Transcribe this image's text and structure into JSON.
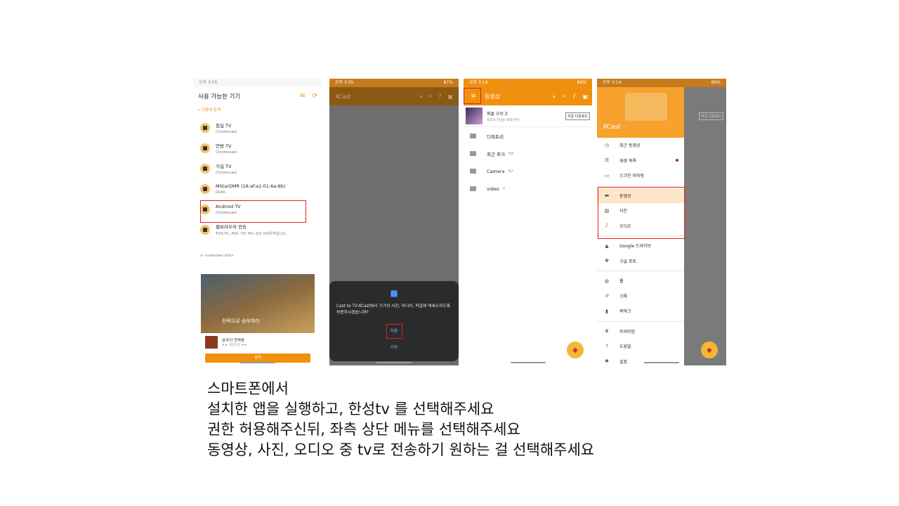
{
  "phone1": {
    "status_time": "오후 3:05",
    "title": "사용 가능한 기기",
    "icons": [
      "mail-icon",
      "refresh-icon"
    ],
    "search_label": "다음에 검색",
    "devices": [
      {
        "name": "침실 TV",
        "type": "Chromecast"
      },
      {
        "name": "안방 TV",
        "type": "Chromecast"
      },
      {
        "name": "거실 TV",
        "type": "Chromecast"
      },
      {
        "name": "MStarDMR (18:af:a1:01:6a:6b)",
        "type": "DLNA"
      },
      {
        "name": "Android TV",
        "type": "Chromecast"
      },
      {
        "name": "웹브라우저 전송",
        "type": "TV와 PC, PS4, 기타 박스 상의 브라우저입니다."
      }
    ],
    "ssid": "<unknown ssid>",
    "ad": {
      "banner_text": "전략으로 승부하라",
      "app_name": "삼국지 전략판",
      "rating": "★★ 게임특징 ★★",
      "install_label": "설치"
    }
  },
  "phone2": {
    "status_time": "오후 3:05",
    "status_battery": "87%",
    "app_title": "XCast",
    "dialog_message": "Cast to TV-XCast에서 기기의 사진, 미디어, 파일에 액세스하도록 허용하시겠습니까?",
    "allow_label": "허용",
    "deny_label": "거부"
  },
  "phone3": {
    "status_time": "오후 3:14",
    "status_battery": "86%",
    "title": "동영상",
    "ad": {
      "name": "퍼즐 오브 Z",
      "sub": "최후의 전선을 위해 전투!",
      "button": "지금 다운로드"
    },
    "folders": [
      {
        "name": "디렉토리",
        "count": ""
      },
      {
        "name": "최근 추가",
        "count": "59"
      },
      {
        "name": "Camera",
        "count": "52"
      },
      {
        "name": "video",
        "count": "7"
      }
    ]
  },
  "phone4": {
    "status_time": "오후 3:14",
    "status_battery": "86%",
    "brand": "XCast",
    "behind_button": "지금 다운로드",
    "groups": [
      [
        {
          "label": "최근 동영상",
          "icon": "clock-icon"
        },
        {
          "label": "재생 목록",
          "icon": "playlist-icon",
          "dot": true
        },
        {
          "label": "스크린 미러링",
          "icon": "mirror-icon"
        }
      ],
      [
        {
          "label": "동영상",
          "icon": "video-icon",
          "selected": true
        },
        {
          "label": "사진",
          "icon": "photo-icon"
        },
        {
          "label": "오디오",
          "icon": "music-icon"
        }
      ],
      [
        {
          "label": "Google 드라이브",
          "icon": "drive-icon"
        },
        {
          "label": "구글 포토",
          "icon": "photos-icon"
        }
      ],
      [
        {
          "label": "웹",
          "icon": "globe-icon"
        },
        {
          "label": "기록",
          "icon": "history-icon"
        },
        {
          "label": "북마크",
          "icon": "bookmark-icon"
        }
      ],
      [
        {
          "label": "프리미엄",
          "icon": "crown-icon"
        },
        {
          "label": "도움말",
          "icon": "help-icon"
        },
        {
          "label": "설정",
          "icon": "settings-icon"
        }
      ]
    ]
  },
  "caption": [
    "스마트폰에서",
    "설치한 앱을 실행하고, 한성tv 를 선택해주세요",
    "권한 허용해주신뒤, 좌측 상단 메뉴를 선택해주세요",
    "동영상, 사진, 오디오 중 tv로 전송하기 원하는 걸 선택해주세요"
  ]
}
